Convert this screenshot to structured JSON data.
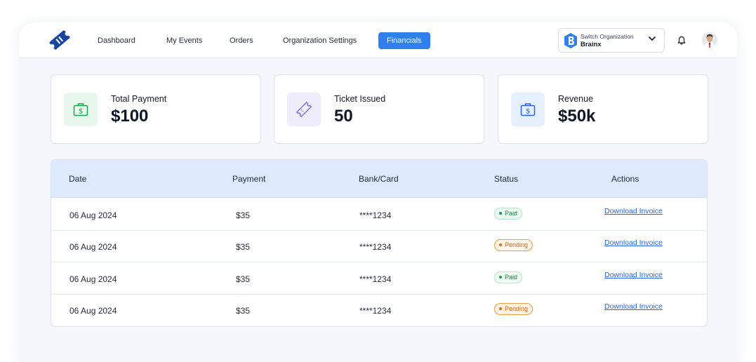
{
  "nav": {
    "items": [
      {
        "label": "Dashboard"
      },
      {
        "label": "My Events"
      },
      {
        "label": "Orders"
      },
      {
        "label": "Organization Settings"
      },
      {
        "label": "Financials",
        "active": true
      }
    ],
    "org_switch_label": "Switch Organization",
    "org_name": "Brainx",
    "icons": [
      "ticket-logo-icon",
      "org-logo-icon",
      "chevron-down-icon",
      "bell-icon",
      "user-avatar"
    ]
  },
  "stats": [
    {
      "label": "Total Payment",
      "value": "$100",
      "icon": "money-bag-icon"
    },
    {
      "label": "Ticket Issued",
      "value": "50",
      "icon": "ticket-icon"
    },
    {
      "label": "Revenue",
      "value": "$50k",
      "icon": "money-bag-icon"
    }
  ],
  "table": {
    "headers": [
      "Date",
      "Payment",
      "Bank/Card",
      "Status",
      "Actions"
    ],
    "rows": [
      {
        "date": "06 Aug 2024",
        "payment": "$35",
        "card": "****1234",
        "status": "Paid",
        "action": "Download Invoice"
      },
      {
        "date": "06 Aug 2024",
        "payment": "$35",
        "card": "****1234",
        "status": "Pending",
        "action": "Download Invoice"
      },
      {
        "date": "06 Aug 2024",
        "payment": "$35",
        "card": "****1234",
        "status": "Paid",
        "action": "Download Invoice"
      },
      {
        "date": "06 Aug 2024",
        "payment": "$35",
        "card": "****1234",
        "status": "Pending",
        "action": "Download Invoice"
      }
    ]
  },
  "colors": {
    "accent": "#2f80ed",
    "paid": "#16a34a",
    "pending": "#ea6c0c",
    "link": "#2563eb",
    "table_header_bg": "#ddeafb"
  }
}
